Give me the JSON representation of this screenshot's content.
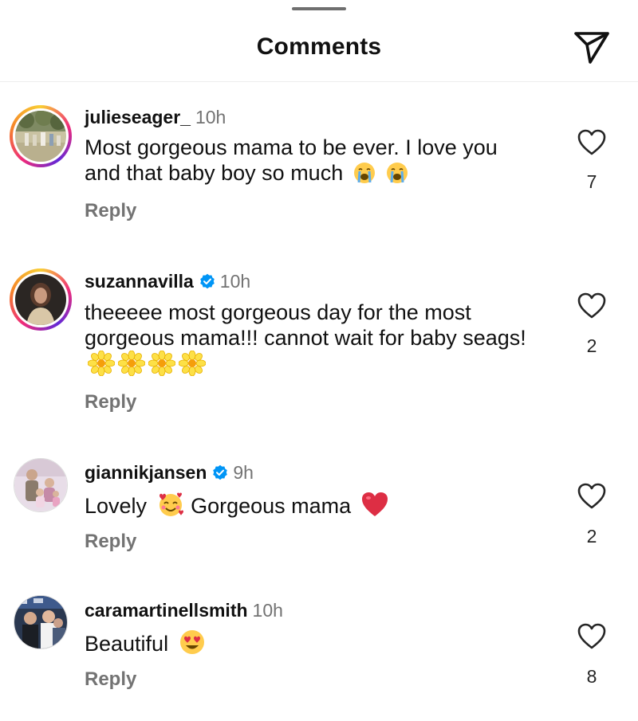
{
  "header": {
    "title": "Comments",
    "share_icon": "send-icon"
  },
  "comments": [
    {
      "username": "julieseager_",
      "verified": false,
      "time": "10h",
      "text": "Most gorgeous mama to be ever. I love you and that baby boy so much",
      "emojis": [
        "loudly-crying-face",
        "loudly-crying-face"
      ],
      "reply_label": "Reply",
      "likes": "7"
    },
    {
      "username": "suzannavilla",
      "verified": true,
      "time": "10h",
      "text": "theeeee most gorgeous day for the most gorgeous mama!!! cannot wait for baby seags!",
      "emojis": [
        "blossom",
        "blossom",
        "blossom",
        "blossom"
      ],
      "reply_label": "Reply",
      "likes": "2"
    },
    {
      "username": "giannikjansen",
      "verified": true,
      "time": "9h",
      "text_before": "Lovely",
      "text_after": "Gorgeous mama",
      "emojis": [
        "smiling-face-with-hearts",
        "red-heart"
      ],
      "reply_label": "Reply",
      "likes": "2"
    },
    {
      "username": "caramartinellsmith",
      "verified": false,
      "time": "10h",
      "text": "Beautiful",
      "emojis": [
        "heart-eyes-face"
      ],
      "reply_label": "Reply",
      "likes": "8"
    }
  ],
  "colors": {
    "text": "#111111",
    "secondary": "#737373",
    "verified": "#0095f6",
    "divider": "#ededed"
  }
}
